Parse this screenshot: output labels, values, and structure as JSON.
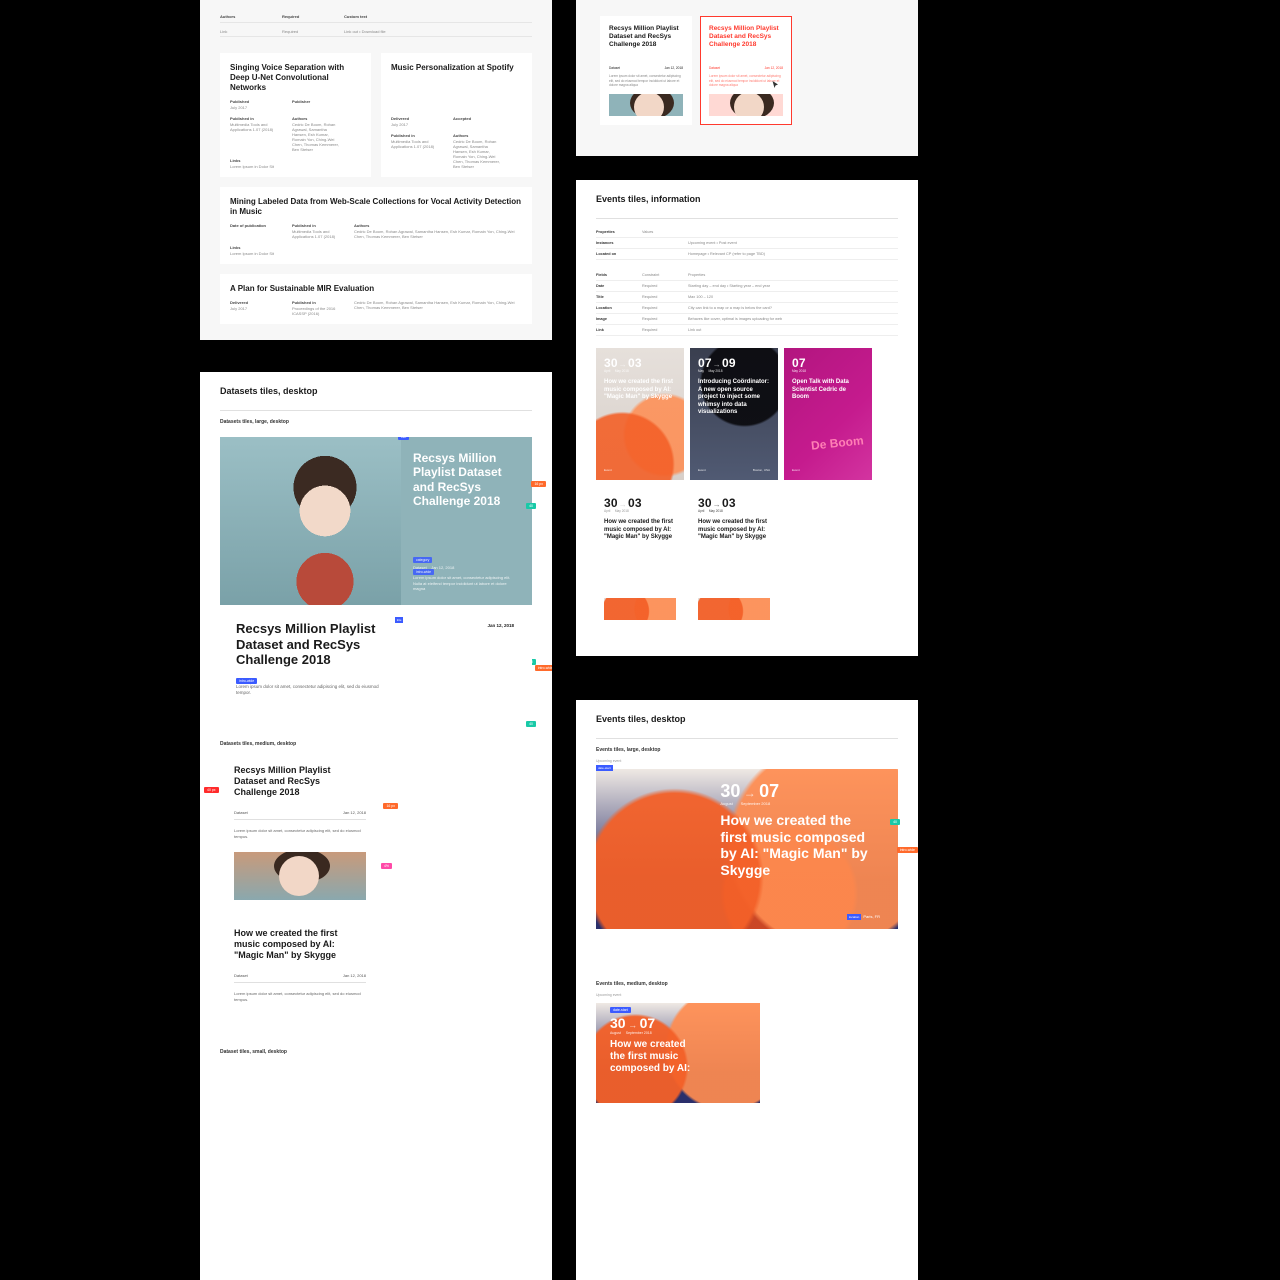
{
  "artboards": {
    "pubs": {
      "card1": {
        "title": "Singing Voice Separation with Deep U-Net Convolutional Networks",
        "meta1": "Published",
        "metaStatusLabel": "Publisher",
        "dateLabel": "Delivered",
        "date": "July 2017",
        "authorsLabel": "Authors",
        "authors": "Cedric De Boom, Rohan Agrawal, Samantha Hansen, Esh Kumar, Romain Yon, Ching-Wei Chen, Thomas Kemmerer, Ben Stetser",
        "venueLabel": "Published in",
        "venue": "Multimedia Tools and Applications 1.07 (2018)",
        "linkLabel": "Links",
        "link": "Lorem Ipsum in Dolor Sit"
      },
      "card2": {
        "title": "Music Personalization at Spotify",
        "metaStatus": "Accepted"
      },
      "card3": {
        "title": "Mining Labeled Data from Web-Scale Collections for Vocal Activity Detection in Music",
        "dop": "Date of publication",
        "dopVal": "Published in",
        "venue": "Multimedia Tools and Applications 1.07 (2018)",
        "authorsLabel": "Authors",
        "authors": "Cedric De Boom, Rohan Agrawal, Samantha Hansen, Esh Kumar, Romain Yon, Ching-Wei Chen, Thomas Kemmerer, Ben Stetser",
        "linkLabel": "Links",
        "link": "Lorem Ipsum in Dolor Sit"
      },
      "card4": {
        "title": "A Plan for Sustainable MIR Evaluation",
        "date": "July 2017",
        "venue": "Proceedings of the 2016 ICASSP (2016)",
        "authors": "Cedric De Boom, Rohan Agrawal, Samantha Hansen, Esh Kumar, Romain Yon, Ching-Wei Chen, Thomas Kemmerer, Ben Stetser"
      },
      "headerCols": {
        "c1": "Authors",
        "c2": "Required",
        "c3": "Custom text"
      }
    },
    "datasets": {
      "sectionTitle": "Datasets tiles, desktop",
      "subLarge": "Datasets tiles, large, desktop",
      "subMedium": "Datasets tiles, medium, desktop",
      "subSmall": "Dataset tiles, small, desktop",
      "hero": {
        "title": "Recsys Million Playlist Dataset and RecSys Challenge 2018",
        "intro": "Lorem ipsum dolor sit amet, consectetur adipiscing elit. Nulla at eleifend tempor incididunt ut labore et dolore magna"
      },
      "white": {
        "title": "Recsys Million Playlist Dataset and RecSys Challenge 2018",
        "date": "Jan 12, 2018",
        "desc": "Lorem ipsum dolor sit amet, consectetur adipiscing elit, sed do eiusmod tempor."
      },
      "medium": {
        "title": "Recsys Million Playlist Dataset and RecSys Challenge 2018",
        "cat": "Dataset",
        "date": "Jan 12, 2018",
        "desc": "Lorem ipsum dolor sit amet, consectetur adipiscing elit, sed do eiusmod tempus."
      },
      "medium2": {
        "title": "How we created the first music composed by AI: \"Magic Man\" by Skygge",
        "cat": "Dataset",
        "date": "Jan 12, 2018",
        "desc": "Lorem ipsum dolor sit amet, consectetur adipiscing elit, sed do eiusmod tempus."
      },
      "markers": {
        "title": "title",
        "category": "category",
        "date": "date",
        "intro": "intro-wide",
        "photo": "photo"
      }
    },
    "hover": {
      "title": "Recsys Million Playlist Dataset and RecSys Challenge 2018",
      "cat": "Dataset",
      "date": "Jan 12, 2018",
      "body": "Lorem ipsum dolor sit amet, consectetur adipiscing elit, sed do eiusmod tempor incididunt ut labore et dolore magna aliqua"
    },
    "eventsInfo": {
      "sectionTitle": "Events tiles, information",
      "propertiesLabel": "Properties",
      "valuesLabel": "Values",
      "rows": [
        {
          "c1": "Instances",
          "c2": "",
          "c3": "Upcoming event • Post event"
        },
        {
          "c1": "Located on",
          "c2": "",
          "c3": "Homepage • Relevant CP (refer to page TBD)"
        }
      ],
      "grid": [
        {
          "c1": "Fields",
          "c2": "Constraint",
          "c3": "Properties"
        },
        {
          "c1": "Date",
          "c2": "Required",
          "c3": "Starting day – end day • Starting year – end year"
        },
        {
          "c1": "Title",
          "c2": "Required",
          "c3": "Max 100 – 120"
        },
        {
          "c1": "Location",
          "c2": "Required",
          "c3": "City can link to a map or a map is below the card?"
        },
        {
          "c1": "Image",
          "c2": "Required",
          "c3": "Behaves like cover, optimal is images uploading for web"
        },
        {
          "c1": "Link",
          "c2": "Required",
          "c3": "Link out"
        }
      ],
      "tiles": {
        "t1": {
          "d1": "30",
          "d2": "03",
          "m1": "April",
          "m2": "May 2018",
          "title": "How we created the first music composed by AI: \"Magic Man\" by Skygge",
          "cat": "Event",
          "loc": ""
        },
        "t2": {
          "d1": "07",
          "d2": "09",
          "m1": "May",
          "m2": "May 2018",
          "title": "Introducing Coördinator: A new open source project to inject some whimsy into data visualizations",
          "cat": "Event",
          "loc": "Boston, USA"
        },
        "t3": {
          "d1": "07",
          "d2": "",
          "m1": "May 2018",
          "m2": "",
          "title": "Open Talk with Data Scientist Cedric de Boom",
          "cat": "Event",
          "loc": ""
        },
        "t4": {
          "d1": "30",
          "d2": "03",
          "m1": "April",
          "m2": "May 2018",
          "title": "How we created the first music composed by AI: \"Magic Man\" by Skygge"
        },
        "t5": {
          "d1": "30",
          "d2": "03",
          "m1": "April",
          "m2": "May 2018",
          "title": "How we created the first music composed by AI: \"Magic Man\" by Skygge"
        }
      }
    },
    "eventsDesk": {
      "sectionTitle": "Events tiles, desktop",
      "subLarge": "Events tiles, large, desktop",
      "subMedium": "Events tiles, medium, desktop",
      "upcomingLabel": "Upcoming event",
      "hero": {
        "d1": "30",
        "d2": "07",
        "m1": "August",
        "m2": "September 2018",
        "title": "How we created the first music composed by AI: \"Magic Man\" by Skygge",
        "loc": "Paris, FR"
      },
      "medium": {
        "d1": "30",
        "d2": "07",
        "m1": "August",
        "m2": "September 2018",
        "title": "How we created the first music composed by AI:"
      },
      "markers": {
        "title": "title",
        "location": "location",
        "dateEnd": "date-end-day",
        "dateStart": "date-start",
        "photo": "photo",
        "loc": "location"
      }
    }
  }
}
